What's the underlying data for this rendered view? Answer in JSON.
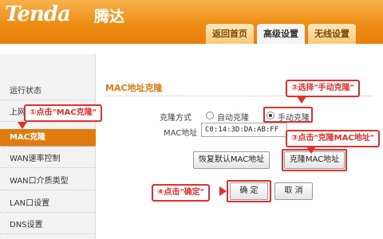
{
  "header": {
    "logo": "Tenda",
    "logo_cn": "腾达",
    "tabs": [
      {
        "label": "返回首页"
      },
      {
        "label": "高级设置"
      },
      {
        "label": "无线设置"
      }
    ],
    "active_tab": "高级设置"
  },
  "sidebar": {
    "items": [
      {
        "label": "运行状态"
      },
      {
        "label": "上网"
      },
      {
        "label": "MAC克隆"
      },
      {
        "label": "WAN速率控制"
      },
      {
        "label": "WAN口介质类型"
      },
      {
        "label": "LAN口设置"
      },
      {
        "label": "DNS设置"
      }
    ],
    "active_item": "MAC克隆"
  },
  "main": {
    "title": "MAC地址克隆",
    "clone_mode_label": "克隆方式",
    "auto_clone_label": "自动克隆",
    "manual_clone_label": "手动克隆",
    "selected_mode": "手动克隆",
    "mac_label": "MAC地址",
    "mac_value": "C0:14:3D:DA:AB:FF",
    "restore_default_button": "恢复默认MAC地址",
    "clone_mac_button": "克隆MAC地址",
    "confirm_button": "确 定",
    "cancel_button": "取 消"
  },
  "annotations": {
    "step1": "①点击\"MAC克隆\"",
    "step2": "②选择\"手动克隆\"",
    "step3": "③点击\"克隆MAC地址\"",
    "step4": "④点击\"确定\""
  },
  "colors": {
    "header_orange": "#ee8d14",
    "accent_orange": "#e07b10",
    "annotation_red": "#e3302c"
  }
}
